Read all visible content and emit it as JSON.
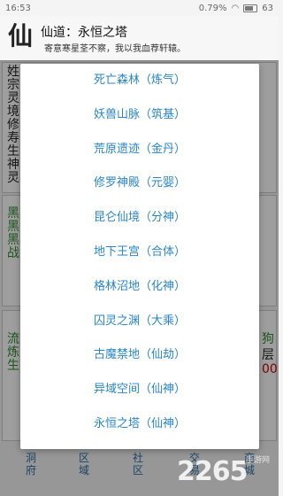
{
  "status": {
    "time": "16:53",
    "battery_pct": "0.79%",
    "battery_level": "63"
  },
  "header": {
    "logo_char": "仙",
    "title": "仙道：永恒之塔",
    "subtitle": "寄意寒星荃不察，我以我血荐轩辕。"
  },
  "background": {
    "col1": "姓宗灵境修寿生神灵",
    "col2": "黑黑黑战",
    "col3": "流炼生",
    "right1": "狗",
    "right2": "层",
    "right3": "00"
  },
  "nav": [
    "洞府",
    "区域",
    "社区",
    "交易",
    "商城"
  ],
  "dialog": {
    "items": [
      "死亡森林（炼气）",
      "妖兽山脉（筑基）",
      "荒原遗迹（金丹）",
      "修罗神殿（元婴）",
      "昆仑仙境（分神）",
      "地下王宫（合体）",
      "格林沼地（化神）",
      "囚灵之渊（大乘）",
      "古魔禁地（仙劫）",
      "异域空间（仙神）",
      "永恒之塔（仙神）"
    ]
  },
  "watermark": {
    "main": "2265",
    "sub": "手游网"
  },
  "colors": {
    "accent": "#2a86c8",
    "overlay": "rgba(0,0,0,0.38)"
  }
}
